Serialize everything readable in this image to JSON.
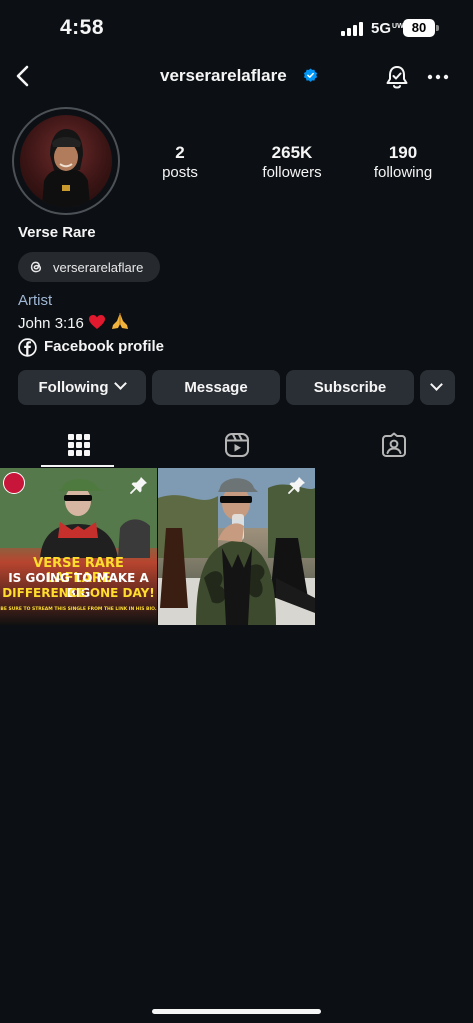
{
  "status_bar": {
    "time": "4:58",
    "network": "5G",
    "network_suffix": "UW",
    "battery": "80"
  },
  "header": {
    "username": "verserarelaflare",
    "verified": true,
    "icons": [
      "back-icon",
      "verified-icon",
      "bell-icon",
      "more-icon"
    ]
  },
  "profile": {
    "stats": {
      "posts_value": "2",
      "posts_label": "posts",
      "followers_value": "265K",
      "followers_label": "followers",
      "following_value": "190",
      "following_label": "following"
    },
    "display_name": "Verse Rare",
    "threads_handle": "verserarelaflare",
    "category": "Artist",
    "bio": "John 3:16",
    "bio_emoji": [
      "❤️",
      "🙏"
    ],
    "link_label": "Facebook profile"
  },
  "actions": {
    "following_label": "Following",
    "message_label": "Message",
    "subscribe_label": "Subscribe"
  },
  "tabs": [
    {
      "name": "grid",
      "active": true
    },
    {
      "name": "reels",
      "active": false
    },
    {
      "name": "tagged",
      "active": false
    }
  ],
  "posts": [
    {
      "pinned": true,
      "overlay_lines": [
        "VERSE RARE LAFLARE",
        "IS GOING TO MAKE A BIG",
        "DIFFERENCE ONE DAY!",
        "BE SURE TO STREAM THIS SINGLE FROM THE LINK IN HIS BIO."
      ]
    },
    {
      "pinned": true,
      "overlay_lines": []
    }
  ],
  "colors": {
    "background": "#0c1014",
    "button": "#2a2f35",
    "verified": "#0095f6",
    "category_text": "#9fb6d4",
    "post_headline": "#ffdd2d"
  }
}
